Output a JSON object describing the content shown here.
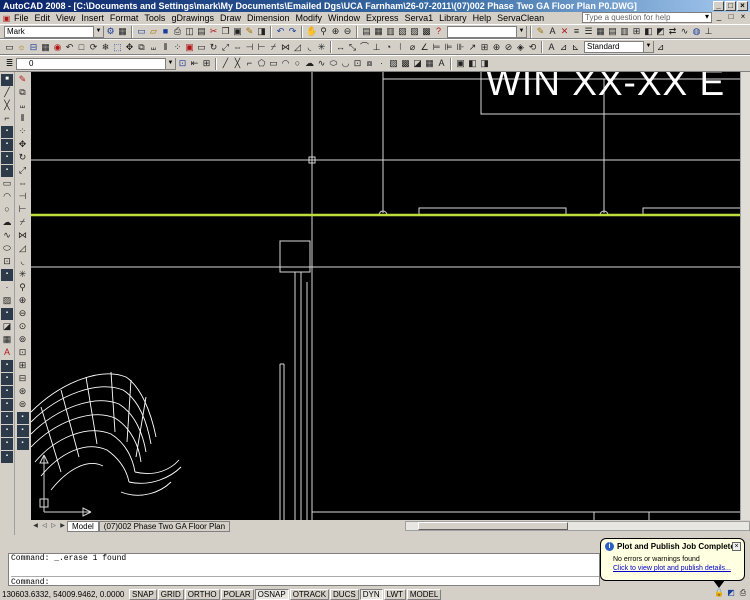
{
  "window": {
    "title": "AutoCAD 2008 - [C:\\Documents and Settings\\mark\\My Documents\\Emailed Dgs\\UCA Farnham\\26-07-2011\\(07)002 Phase Two GA Floor Plan P0.DWG]",
    "controls": [
      "_",
      "□",
      "×"
    ]
  },
  "menu": {
    "items": [
      "File",
      "Edit",
      "View",
      "Insert",
      "Format",
      "Tools",
      "gDrawings",
      "Draw",
      "Dimension",
      "Modify",
      "Window",
      "Express",
      "Serva1",
      "Library",
      "Help",
      "ServaClean"
    ],
    "help_placeholder": "Type a question for help",
    "controls": [
      "▾",
      "_",
      "□",
      "×"
    ]
  },
  "toolbar1": {
    "workspace_combo": "Mark"
  },
  "toolbar2": {
    "style_combo": "Standard"
  },
  "toolbar3": {
    "layer_combo": "0"
  },
  "canvas": {
    "banner_text": "WIN XX-XX E",
    "accent_line_color": "#bedc3c"
  },
  "layout_tabs": [
    "Model",
    "(07)002 Phase Two GA Floor Plan"
  ],
  "command": {
    "history": "Command: _.erase 1 found",
    "prompt": "Command:"
  },
  "status": {
    "coords": "130603.6332, 54009.9462, 0.0000",
    "toggles": [
      {
        "label": "SNAP",
        "on": false
      },
      {
        "label": "GRID",
        "on": false
      },
      {
        "label": "ORTHO",
        "on": false
      },
      {
        "label": "POLAR",
        "on": false
      },
      {
        "label": "OSNAP",
        "on": true
      },
      {
        "label": "OTRACK",
        "on": false
      },
      {
        "label": "DUCS",
        "on": false
      },
      {
        "label": "DYN",
        "on": true
      },
      {
        "label": "LWT",
        "on": false
      },
      {
        "label": "MODEL",
        "on": false
      }
    ]
  },
  "notification": {
    "title": "Plot and Publish Job Complete",
    "message": "No errors or warnings found",
    "link": "Click to view plot and publish details..."
  }
}
